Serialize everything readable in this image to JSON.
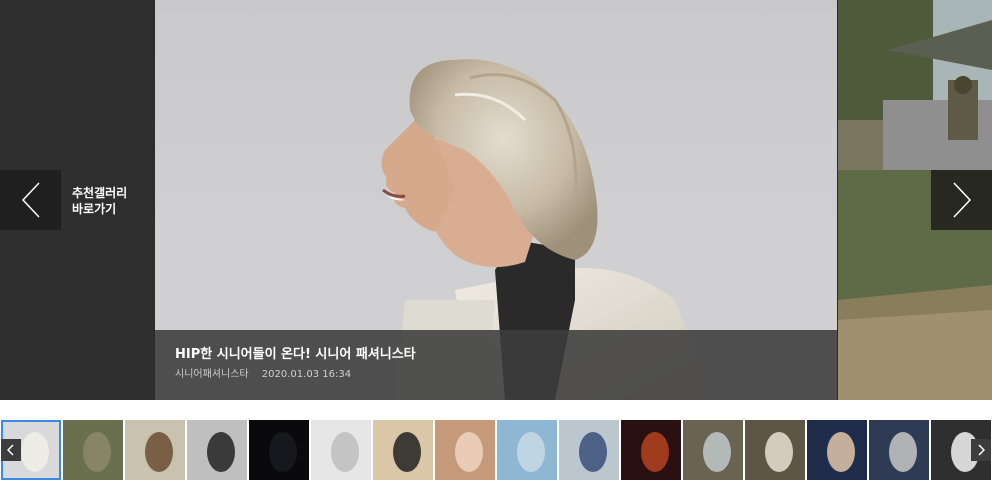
{
  "gallery": {
    "goto_label": "추천갤러리\n바로가기",
    "prev_icon": "chevron-left-icon",
    "next_icon": "chevron-right-icon"
  },
  "slide": {
    "title": "HIP한 시니어들이 온다! 시니어 패셔니스타",
    "category": "시니어패셔니스타",
    "date": "2020.01.03 16:34"
  },
  "thumbnails": {
    "count": 16,
    "active_index": 0,
    "items": [
      "senior-fashion",
      "military-camouflage",
      "wreath",
      "man-coat",
      "night-sky",
      "snowman",
      "man-suit",
      "child-face",
      "beach",
      "woman-building",
      "wildfire",
      "waterfall-rocks",
      "workers-hardhats",
      "official-portrait",
      "man-suit-2",
      "athlete-ball"
    ]
  },
  "colors": {
    "accent": "#3a8be8",
    "caption_bg": "#3c3c3c",
    "panel_bg": "#2e2e2e"
  }
}
